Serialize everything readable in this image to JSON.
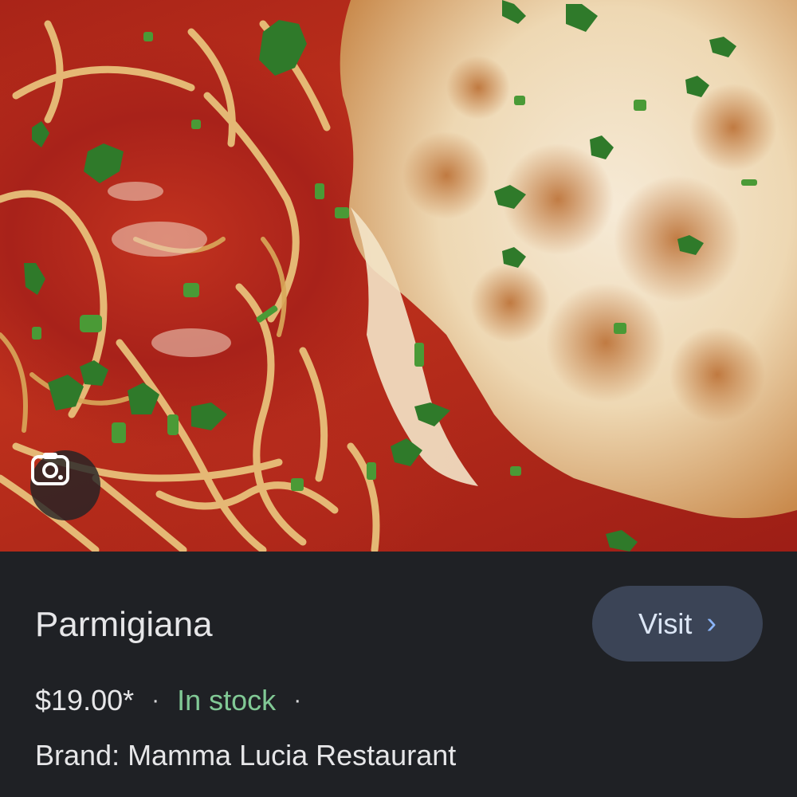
{
  "image": {
    "icon": "lens-search-icon",
    "colors": {
      "sauce": "#b52a1c",
      "cheese": "#f3e6cf",
      "spaghetti": "#e9c27a",
      "parsley": "#2f7a2a"
    }
  },
  "product": {
    "title": "Parmigiana",
    "price": "$19.00*",
    "separator": "·",
    "stock_status": "In stock",
    "brand_label": "Brand: Mamma Lucia Restaurant"
  },
  "visit_button": {
    "label": "Visit",
    "chevron": "›",
    "icon": "chevron-right-icon"
  },
  "theme": {
    "panel_bg": "#1f2125",
    "button_bg": "#3b4456",
    "stock_color": "#81c995",
    "chevron_color": "#8ab4f8"
  }
}
